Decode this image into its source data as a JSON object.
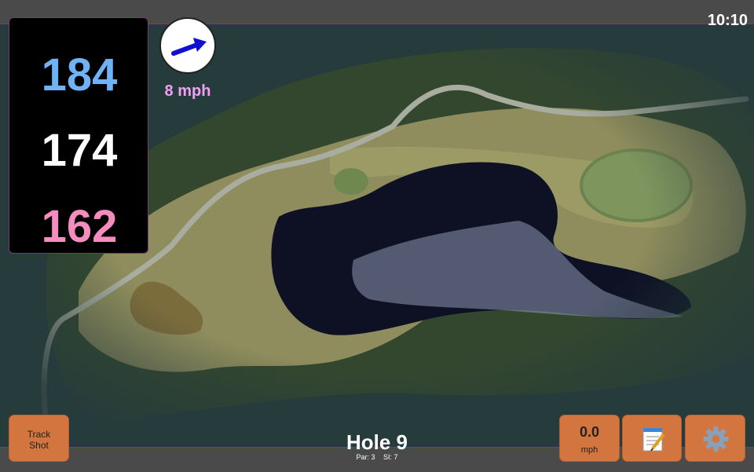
{
  "status": {
    "time": "10:10"
  },
  "distances": {
    "back": "184",
    "center": "174",
    "front": "162"
  },
  "wind": {
    "speed": "8 mph",
    "direction_icon": "wind-arrow-icon"
  },
  "hole": {
    "title": "Hole 9",
    "par": "Par: 3",
    "stroke_index": "SI: 7"
  },
  "buttons": {
    "track_shot_line1": "Track",
    "track_shot_line2": "Shot",
    "speed_value": "0.0",
    "speed_unit": "mph",
    "notes_icon": "notepad-icon",
    "settings_icon": "gear-icon"
  },
  "colors": {
    "back": "#6fb2f5",
    "center": "#ffffff",
    "front": "#f58cc0",
    "button": "#d2753f",
    "wind_text": "#f0a0f0"
  }
}
